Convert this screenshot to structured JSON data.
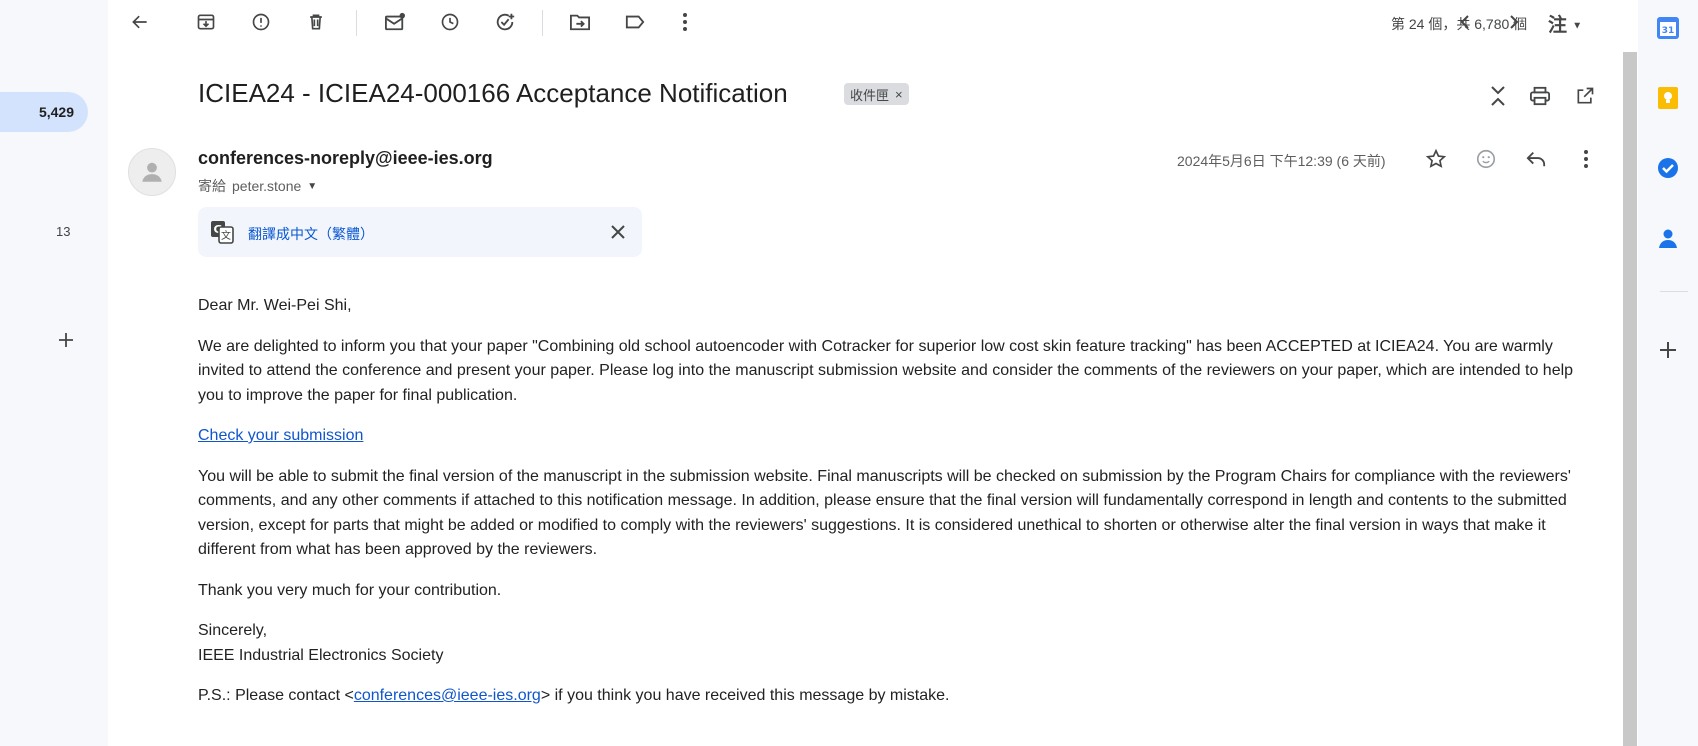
{
  "left_rail": {
    "inbox_count": "5,429",
    "secondary_count": "13"
  },
  "toolbar": {
    "pager_text": "第 24 個，共 6,780 個",
    "input_tool_label": "注"
  },
  "email": {
    "subject": "ICIEA24 - ICIEA24-000166 Acceptance Notification",
    "label_chip": "收件匣",
    "sender": "conferences-noreply@ieee-ies.org",
    "to_prefix": "寄給",
    "to_name": "peter.stone",
    "date": "2024年5月6日 下午12:39 (6 天前)",
    "translate_link": "翻譯成中文（繁體）",
    "body": {
      "greeting": "Dear Mr. Wei-Pei Shi,",
      "para1": "We are delighted to inform you that your paper \"Combining old school autoencoder with Cotracker for superior low cost skin feature tracking\" has been ACCEPTED at ICIEA24. You are warmly invited to attend the conference and present your paper. Please log into the manuscript submission website and consider the comments of the reviewers on your paper, which are intended to help you to improve the paper for final publication.",
      "link_text": "Check your submission",
      "para2": "You will be able to submit the final version of the manuscript in the submission website. Final manuscripts will be checked on submission by the Program Chairs for compliance with the reviewers' comments, and any other comments if attached to this notification message. In addition, please ensure that the final version will fundamentally correspond in length and contents to the submitted version, except for parts that might be added or modified to comply with the reviewers' suggestions. It is considered unethical to shorten or otherwise alter the final version in ways that make it different from what has been approved by the reviewers.",
      "thanks": "Thank you very much for your contribution.",
      "closing": "Sincerely,",
      "signature": "IEEE Industrial Electronics Society",
      "ps_prefix": "P.S.: Please contact <",
      "ps_email": "conferences@ieee-ies.org",
      "ps_suffix": "> if you think you have received this message by mistake."
    }
  },
  "right_rail": {
    "calendar_day": "31"
  },
  "colors": {
    "accent_blue": "#0b57d0",
    "pill_bg": "#d3e3fd",
    "keep_yellow": "#fbbc04",
    "link": "#1155cc"
  }
}
